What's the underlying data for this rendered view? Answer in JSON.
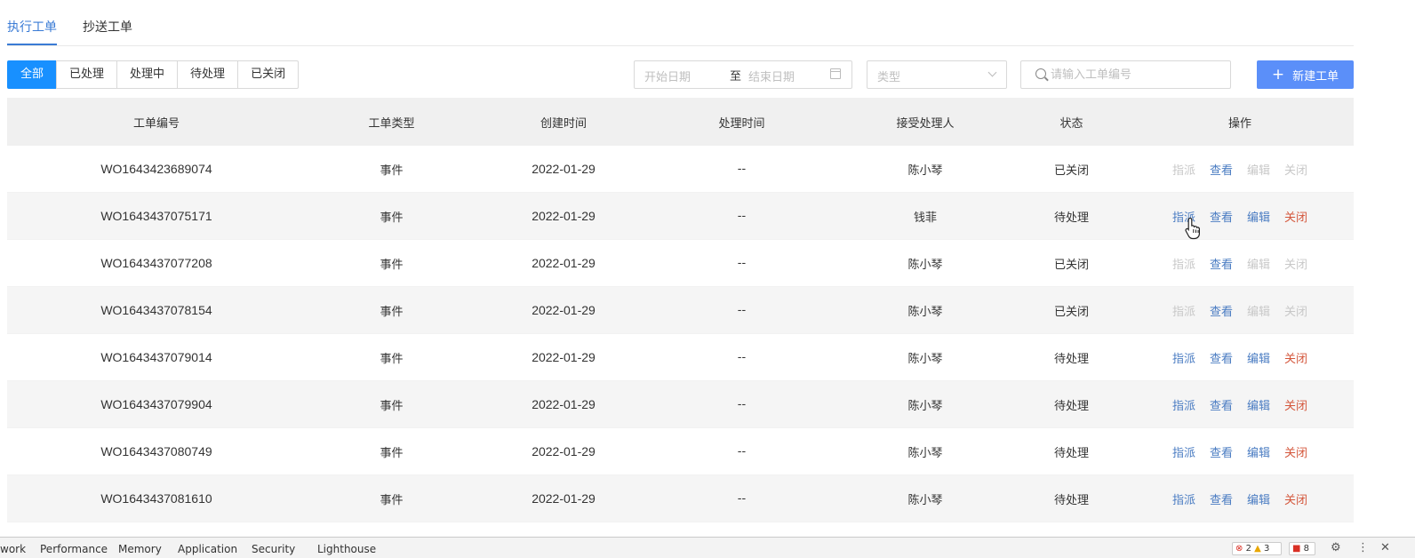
{
  "tabs": [
    {
      "label": "执行工单",
      "active": true
    },
    {
      "label": "抄送工单",
      "active": false
    }
  ],
  "filters": {
    "buttons": [
      {
        "label": "全部",
        "active": true
      },
      {
        "label": "已处理",
        "active": false
      },
      {
        "label": "处理中",
        "active": false
      },
      {
        "label": "待处理",
        "active": false
      },
      {
        "label": "已关闭",
        "active": false
      }
    ],
    "date_start_placeholder": "开始日期",
    "date_separator": "至",
    "date_end_placeholder": "结束日期",
    "type_placeholder": "类型",
    "search_placeholder": "请输入工单编号",
    "new_button_label": "新建工单"
  },
  "table": {
    "columns": [
      "工单编号",
      "工单类型",
      "创建时间",
      "处理时间",
      "接受处理人",
      "状态",
      "操作"
    ],
    "actions": [
      "指派",
      "查看",
      "编辑",
      "关闭"
    ],
    "rows": [
      {
        "id": "WO1643423689074",
        "type": "事件",
        "created": "2022-01-29",
        "handled": "--",
        "assignee": "陈小琴",
        "status": "已关闭"
      },
      {
        "id": "WO1643437075171",
        "type": "事件",
        "created": "2022-01-29",
        "handled": "--",
        "assignee": "钱菲",
        "status": "待处理"
      },
      {
        "id": "WO1643437077208",
        "type": "事件",
        "created": "2022-01-29",
        "handled": "--",
        "assignee": "陈小琴",
        "status": "已关闭"
      },
      {
        "id": "WO1643437078154",
        "type": "事件",
        "created": "2022-01-29",
        "handled": "--",
        "assignee": "陈小琴",
        "status": "已关闭"
      },
      {
        "id": "WO1643437079014",
        "type": "事件",
        "created": "2022-01-29",
        "handled": "--",
        "assignee": "陈小琴",
        "status": "待处理"
      },
      {
        "id": "WO1643437079904",
        "type": "事件",
        "created": "2022-01-29",
        "handled": "--",
        "assignee": "陈小琴",
        "status": "待处理"
      },
      {
        "id": "WO1643437080749",
        "type": "事件",
        "created": "2022-01-29",
        "handled": "--",
        "assignee": "陈小琴",
        "status": "待处理"
      },
      {
        "id": "WO1643437081610",
        "type": "事件",
        "created": "2022-01-29",
        "handled": "--",
        "assignee": "陈小琴",
        "status": "待处理"
      }
    ]
  },
  "devtools": {
    "tabs": [
      "work",
      "Performance",
      "Memory",
      "Application",
      "Security",
      "Lighthouse"
    ],
    "errors": "2",
    "warnings": "3",
    "issues": "8"
  },
  "colors": {
    "primary": "#1890ff",
    "new_button": "#5b8ff9",
    "action_blue": "#4a7cc2",
    "action_red": "#d4573c",
    "action_disabled": "#c8c8c8"
  }
}
